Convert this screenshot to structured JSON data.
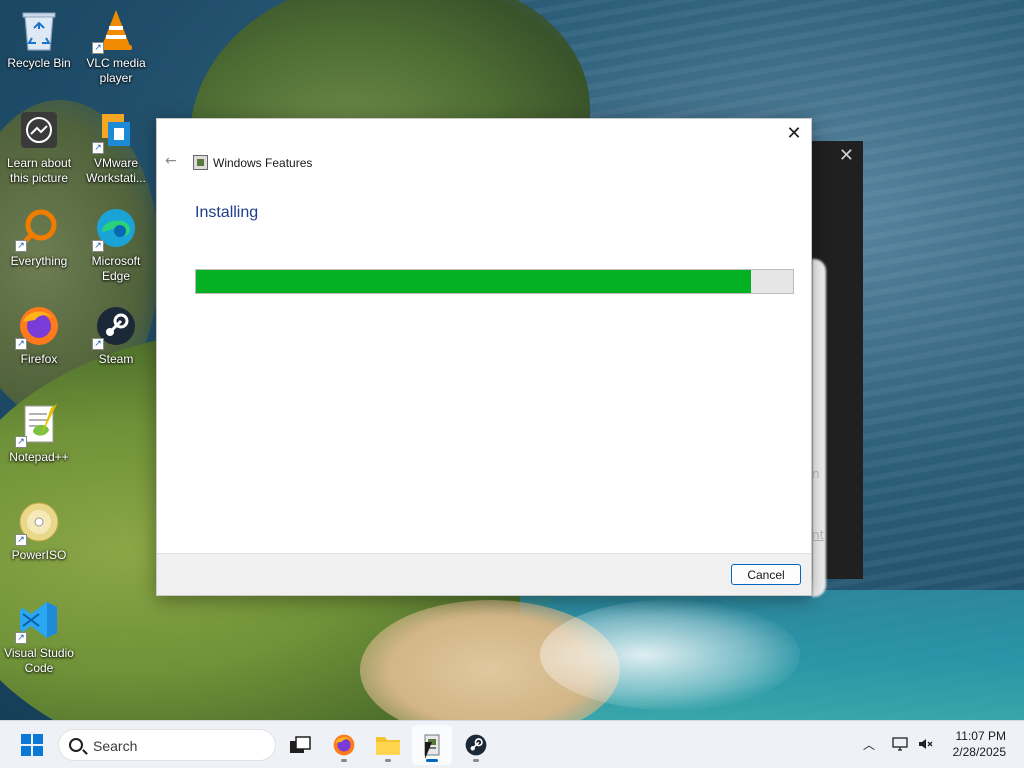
{
  "desktop": {
    "icons": [
      {
        "label": "Recycle Bin",
        "icon": "recycle-bin-icon"
      },
      {
        "label": "VLC media player",
        "icon": "vlc-icon"
      },
      {
        "label": "Learn about this picture",
        "icon": "learn-picture-icon"
      },
      {
        "label": "VMware Workstati...",
        "icon": "vmware-icon"
      },
      {
        "label": "Everything",
        "icon": "everything-search-icon"
      },
      {
        "label": "Microsoft Edge",
        "icon": "edge-icon"
      },
      {
        "label": "Firefox",
        "icon": "firefox-icon"
      },
      {
        "label": "Steam",
        "icon": "steam-icon"
      },
      {
        "label": "Notepad++",
        "icon": "notepadpp-icon"
      },
      {
        "label": "PowerISO",
        "icon": "poweriso-icon"
      },
      {
        "label": "Visual Studio Code",
        "icon": "vscode-icon"
      }
    ]
  },
  "background_dialog": {
    "fragment_1": "n",
    "fragment_2": "nt"
  },
  "dialog": {
    "title": "Windows Features",
    "heading": "Installing",
    "progress": 0.93,
    "cancel_label": "Cancel",
    "colors": {
      "progress_fill": "#06b025",
      "heading": "#1e3d8a"
    }
  },
  "taskbar": {
    "search_placeholder": "Search",
    "apps": [
      {
        "name": "task-view",
        "icon": "task-view-icon"
      },
      {
        "name": "firefox",
        "icon": "firefox-icon"
      },
      {
        "name": "file-explorer",
        "icon": "folder-icon"
      },
      {
        "name": "windows-features",
        "icon": "windows-features-icon",
        "active": true
      },
      {
        "name": "steam",
        "icon": "steam-icon"
      }
    ],
    "clock": {
      "time": "11:07 PM",
      "date": "2/28/2025"
    }
  }
}
